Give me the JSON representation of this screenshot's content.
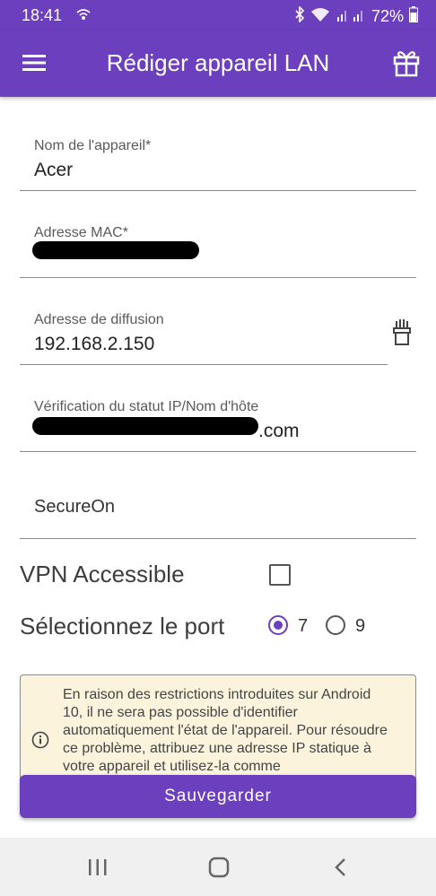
{
  "status": {
    "time": "18:41",
    "battery": "72%"
  },
  "header": {
    "title": "Rédiger appareil LAN"
  },
  "fields": {
    "device_name": {
      "label": "Nom de l'appareil*",
      "value": "Acer"
    },
    "mac": {
      "label": "Adresse MAC*"
    },
    "broadcast": {
      "label": "Adresse de diffusion",
      "value": "192.168.2.150"
    },
    "status_check": {
      "label": "Vérification du statut IP/Nom d'hôte",
      "value_suffix": ".com"
    },
    "secureon": {
      "placeholder": "SecureOn"
    }
  },
  "vpn": {
    "label": "VPN Accessible",
    "checked": false
  },
  "port": {
    "label": "Sélectionnez le port",
    "options": [
      "7",
      "9"
    ],
    "selected": "7"
  },
  "notice": {
    "text": "En raison des restrictions introduites sur Android 10, il ne sera pas possible d'identifier automatiquement l'état de l'appareil. Pour résoudre ce problème, attribuez une adresse IP statique à votre appareil et utilisez-la comme"
  },
  "save_button": {
    "label": "Sauvegarder"
  },
  "colors": {
    "accent": "#6b3fbd",
    "notice_bg": "#fbf3dc"
  },
  "icons": [
    "wifi-calling-icon",
    "bluetooth-icon",
    "wifi-icon",
    "signal-icon",
    "battery-icon",
    "menu-icon",
    "gift-icon",
    "lookup-icon",
    "info-icon",
    "recent-apps-icon",
    "home-icon",
    "back-icon"
  ]
}
